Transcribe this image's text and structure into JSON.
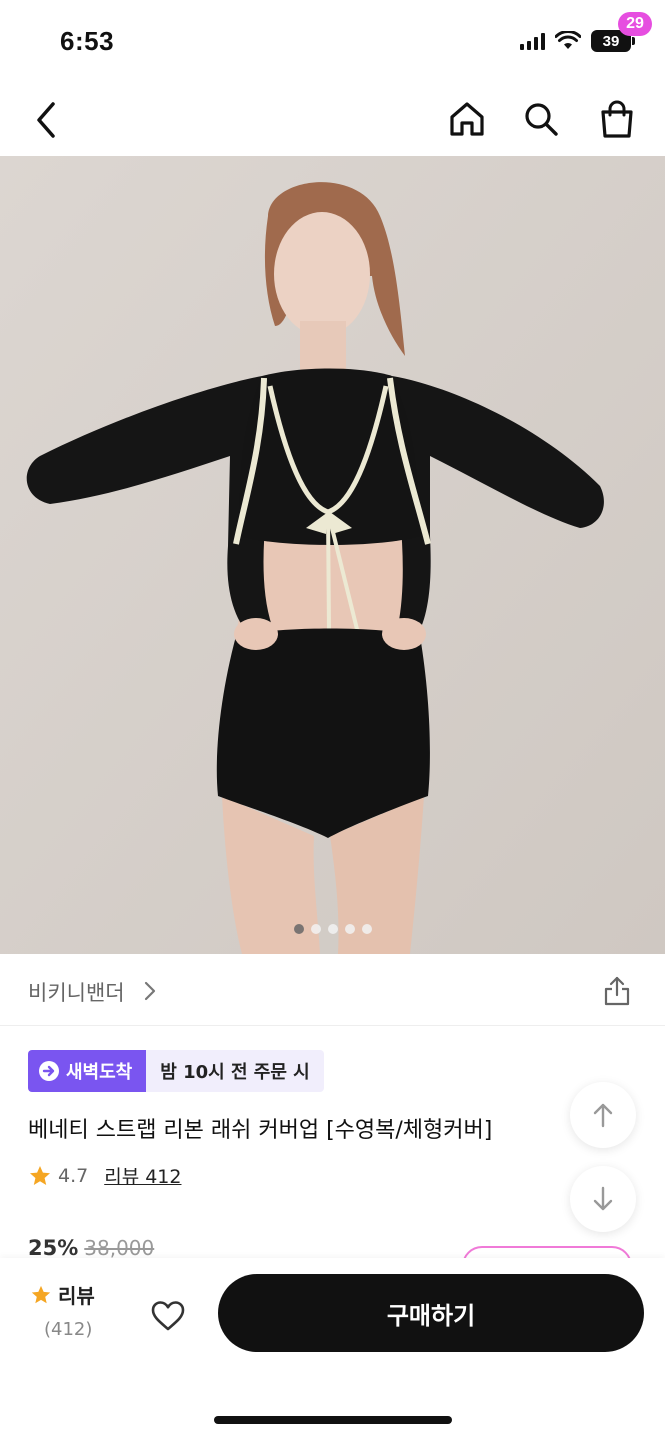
{
  "status_bar": {
    "time": "6:53",
    "battery": "39",
    "icons": [
      "cellular-signal-icon",
      "wifi-icon",
      "battery-icon"
    ]
  },
  "nav": {
    "cart_count": "29",
    "icons": [
      "back-arrow-icon",
      "home-icon",
      "search-icon",
      "shopping-bag-icon"
    ]
  },
  "gallery": {
    "image_count": 5,
    "active_index": 0
  },
  "brand": {
    "name": "비키니밴더"
  },
  "delivery": {
    "badge": "새벽도착",
    "note": "밤 10시 전 주문 시"
  },
  "product": {
    "title": "베네티 스트랩 리본 래쉬 커버업 [수영복/체형커버]",
    "rating": "4.7",
    "review_link": "리뷰 412",
    "discount": "25%",
    "original_price": "38,000"
  },
  "bottom_bar": {
    "review_label": "리뷰",
    "review_count": "(412)",
    "buy_label": "구매하기"
  },
  "colors": {
    "accent_purple": "#7a55f0",
    "badge_pink": "#e64ee0",
    "star": "#f5a623",
    "buy_button": "#111111"
  }
}
